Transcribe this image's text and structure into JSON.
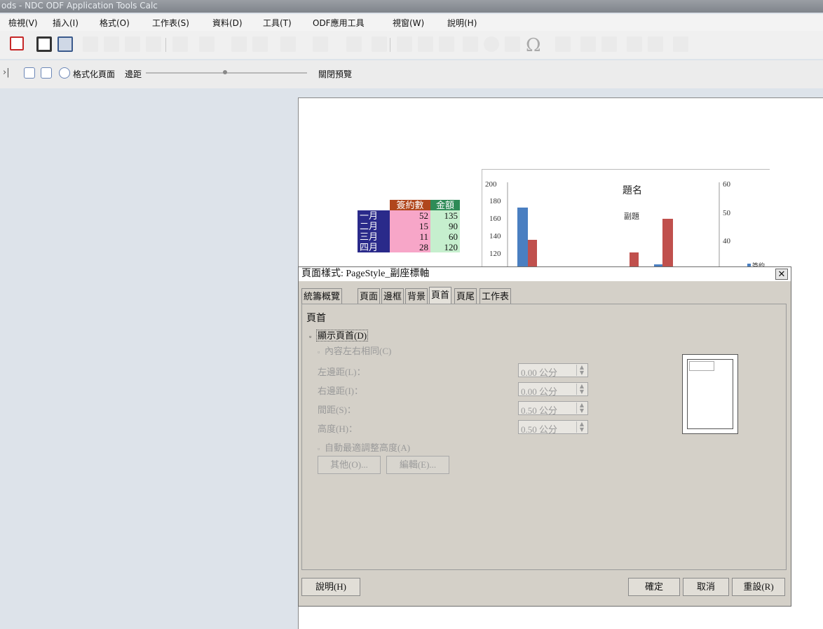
{
  "window": {
    "title": "ods - NDC ODF Application Tools Calc"
  },
  "menu": {
    "items": [
      "檢視(V)",
      "插入(I)",
      "格式(O)",
      "工作表(S)",
      "資料(D)",
      "工具(T)",
      "ODF應用工具",
      "視窗(W)",
      "說明(H)"
    ]
  },
  "previewbar": {
    "format_page": "格式化頁面",
    "margins": "邊距",
    "close_preview": "關閉預覽"
  },
  "sheet": {
    "table": {
      "headers": [
        "簽約數",
        "金額"
      ],
      "rows": [
        {
          "label": "一月",
          "count": "52",
          "amount": "135"
        },
        {
          "label": "二月",
          "count": "15",
          "amount": "90"
        },
        {
          "label": "三月",
          "count": "11",
          "amount": "60"
        },
        {
          "label": "四月",
          "count": "28",
          "amount": "120"
        }
      ]
    }
  },
  "chart_data": {
    "type": "bar",
    "title": "題名",
    "subtitle": "副題",
    "left_axis": {
      "ticks": [
        "200",
        "180",
        "160",
        "140",
        "120"
      ]
    },
    "right_axis": {
      "ticks": [
        "60",
        "50",
        "40"
      ]
    },
    "legend_partial": "簽約",
    "series_colors": {
      "blue": "#4a7fc1",
      "red": "#c0504d"
    }
  },
  "dialog": {
    "title": "頁面樣式: PageStyle_副座標軸",
    "close": "✕",
    "tabs": [
      "統籌概覽",
      "頁面",
      "邊框",
      "背景",
      "頁首",
      "頁尾",
      "工作表"
    ],
    "active_tab": "頁首",
    "section": "頁首",
    "show_header": "顯示頁首(D)",
    "same_content": "內容左右相同(C)",
    "auto_fit": "自動最適調整高度(A)",
    "fields": [
      {
        "label": "左邊距(L)：",
        "value": "0.00 公分"
      },
      {
        "label": "右邊距(I)：",
        "value": "0.00 公分"
      },
      {
        "label": "間距(S)：",
        "value": "0.50 公分"
      },
      {
        "label": "高度(H)：",
        "value": "0.50 公分"
      }
    ],
    "more_button": "其他(O)...",
    "edit_button": "編輯(E)...",
    "help_button": "說明(H)",
    "ok_button": "確定",
    "cancel_button": "取消",
    "reset_button": "重設(R)"
  }
}
